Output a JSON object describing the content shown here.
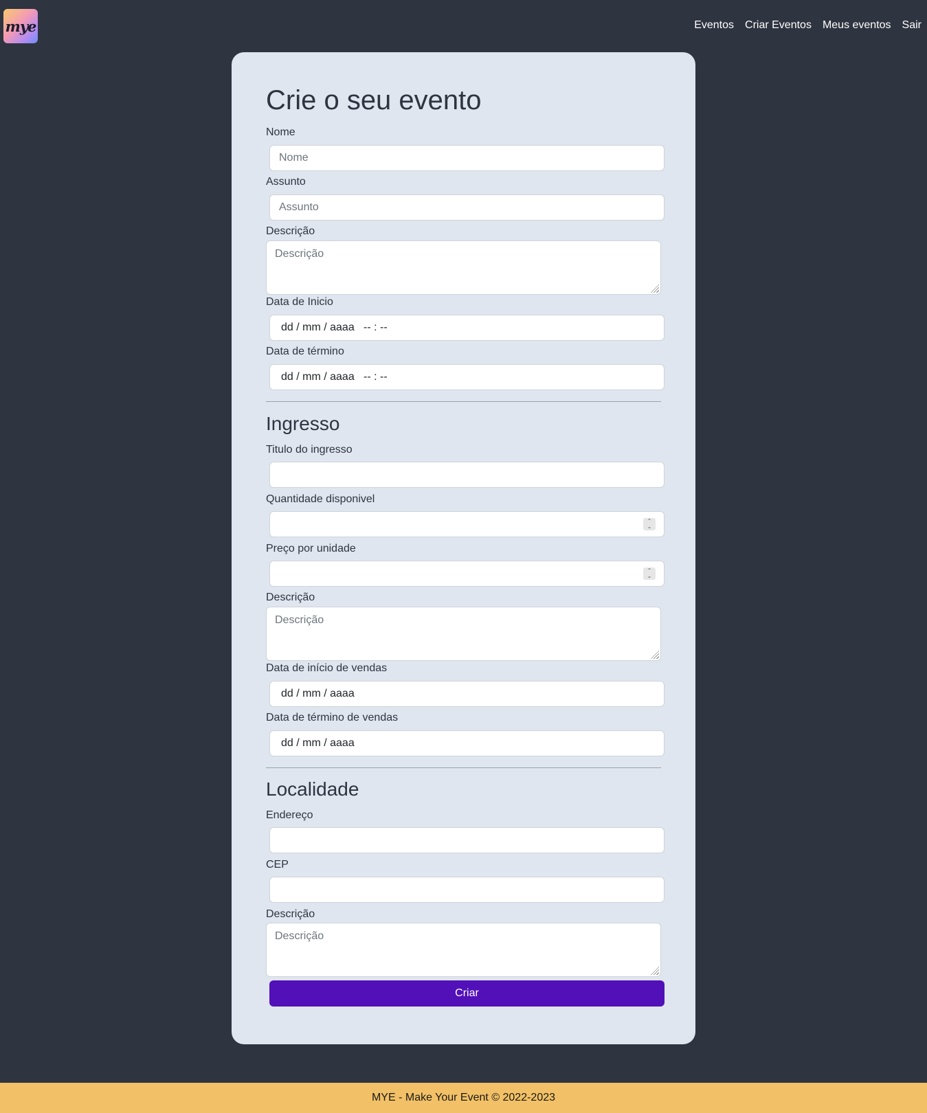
{
  "brand": {
    "logo_text": "mye"
  },
  "nav": {
    "links": [
      "Eventos",
      "Criar Eventos",
      "Meus eventos",
      "Sair"
    ]
  },
  "form": {
    "title": "Crie o seu evento",
    "event": {
      "name_label": "Nome",
      "name_placeholder": "Nome",
      "subject_label": "Assunto",
      "subject_placeholder": "Assunto",
      "description_label": "Descrição",
      "description_placeholder": "Descrição",
      "start_label": "Data de Inicio",
      "start_value": "dd / mm / aaaa   -- : --",
      "end_label": "Data de término",
      "end_value": "dd / mm / aaaa   -- : --"
    },
    "ticket": {
      "section_title": "Ingresso",
      "title_label": "Titulo do ingresso",
      "quantity_label": "Quantidade disponivel",
      "price_label": "Preço por unidade",
      "description_label": "Descrição",
      "description_placeholder": "Descrição",
      "sales_start_label": "Data de início de vendas",
      "sales_start_value": "dd / mm / aaaa",
      "sales_end_label": "Data de término de vendas",
      "sales_end_value": "dd / mm / aaaa"
    },
    "location": {
      "section_title": "Localidade",
      "address_label": "Endereço",
      "cep_label": "CEP",
      "description_label": "Descrição",
      "description_placeholder": "Descrição"
    },
    "submit_label": "Criar"
  },
  "footer": {
    "text": "MYE - Make Your Event © 2022-2023"
  },
  "colors": {
    "background": "#2e3440",
    "card": "#dfe6ef",
    "primary_button": "#5210b8",
    "footer": "#f2c066"
  }
}
